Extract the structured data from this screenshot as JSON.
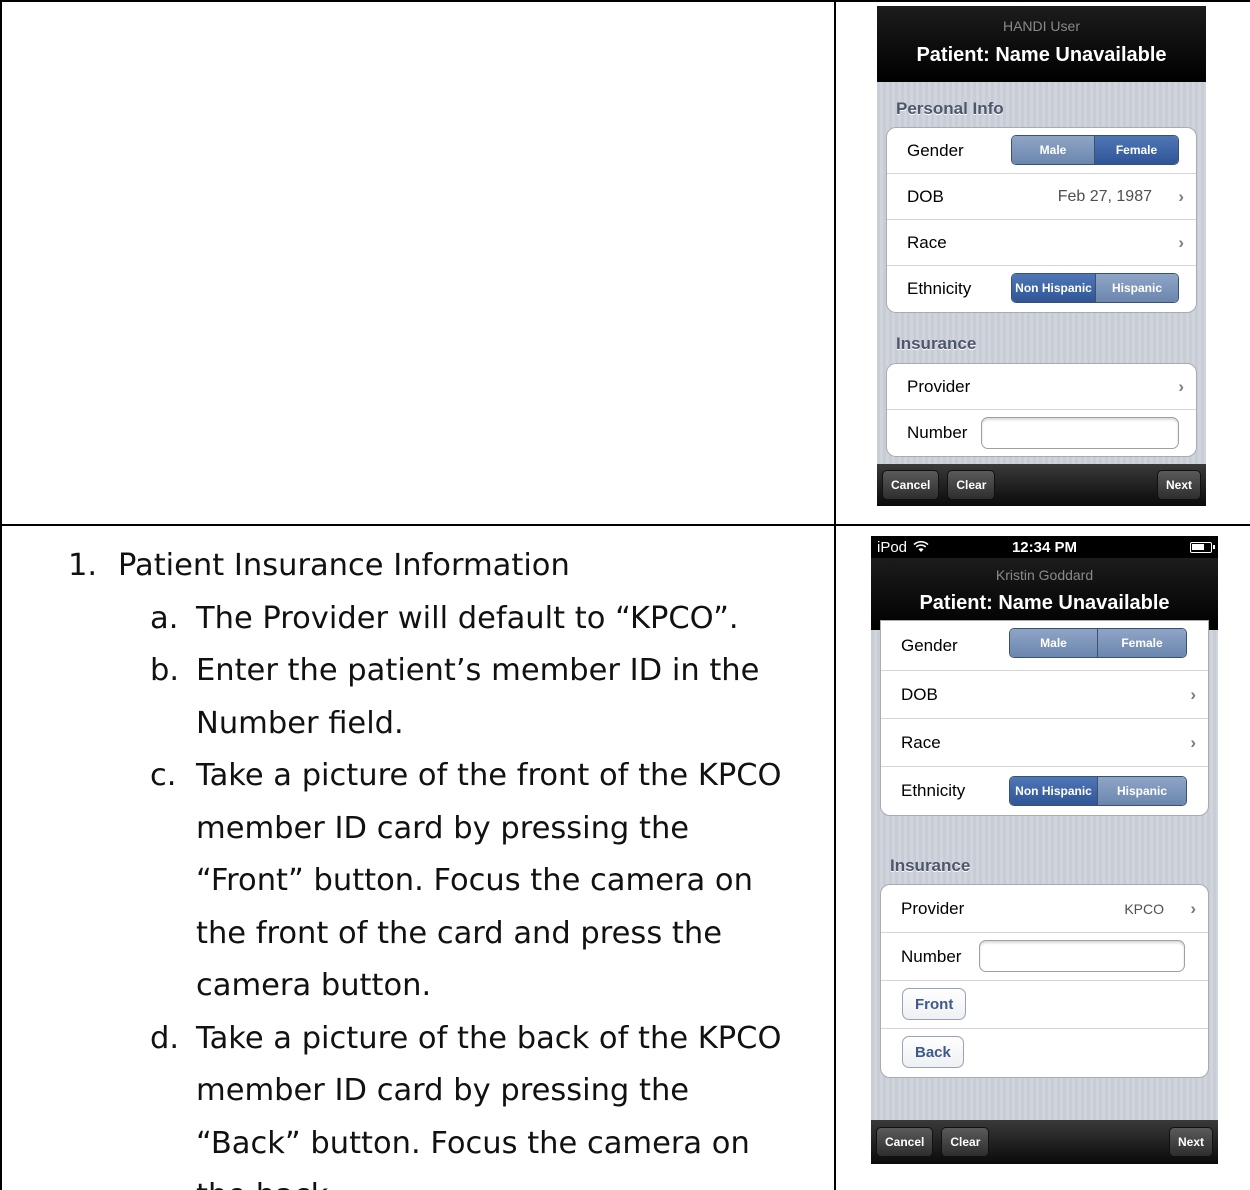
{
  "instructions": {
    "step_number": "1.",
    "step_title": "Patient Insurance Information",
    "substeps": [
      {
        "letter": "a.",
        "text": "The Provider will default to “KPCO”."
      },
      {
        "letter": "b.",
        "text": "Enter the patient’s member ID in the Number field."
      },
      {
        "letter": "c.",
        "text": "Take a picture of the front of the KPCO member ID card by pressing the “Front” button.  Focus the camera on the front of the card and press the camera button."
      },
      {
        "letter": "d.",
        "text": "Take a picture of the back of the KPCO member ID card by pressing the “Back” button.  Focus the camera on the back"
      }
    ]
  },
  "screen1": {
    "user": "HANDI User",
    "title": "Patient: Name Unavailable",
    "personal_header": "Personal Info",
    "gender_label": "Gender",
    "gender_options": [
      "Male",
      "Female"
    ],
    "gender_selected": "Female",
    "dob_label": "DOB",
    "dob_value": "Feb 27, 1987",
    "race_label": "Race",
    "ethnicity_label": "Ethnicity",
    "ethnicity_options": [
      "Non Hispanic",
      "Hispanic"
    ],
    "ethnicity_selected": "Non Hispanic",
    "insurance_header": "Insurance",
    "provider_label": "Provider",
    "number_label": "Number",
    "number_value": "",
    "chevron": "›",
    "toolbar": {
      "cancel": "Cancel",
      "clear": "Clear",
      "next": "Next"
    }
  },
  "screen2": {
    "status": {
      "carrier": "iPod",
      "time": "12:34 PM",
      "wifi_icon": "wifi-icon",
      "battery_icon": "battery-icon"
    },
    "user": "Kristin Goddard",
    "title": "Patient: Name Unavailable",
    "gender_label": "Gender",
    "gender_options": [
      "Male",
      "Female"
    ],
    "dob_label": "DOB",
    "race_label": "Race",
    "ethnicity_label": "Ethnicity",
    "ethnicity_options": [
      "Non Hispanic",
      "Hispanic"
    ],
    "ethnicity_selected": "Non Hispanic",
    "insurance_header": "Insurance",
    "provider_label": "Provider",
    "provider_value": "KPCO",
    "number_label": "Number",
    "number_value": "",
    "front_label": "Front",
    "back_label": "Back",
    "chevron": "›",
    "toolbar": {
      "cancel": "Cancel",
      "clear": "Clear",
      "next": "Next"
    }
  }
}
